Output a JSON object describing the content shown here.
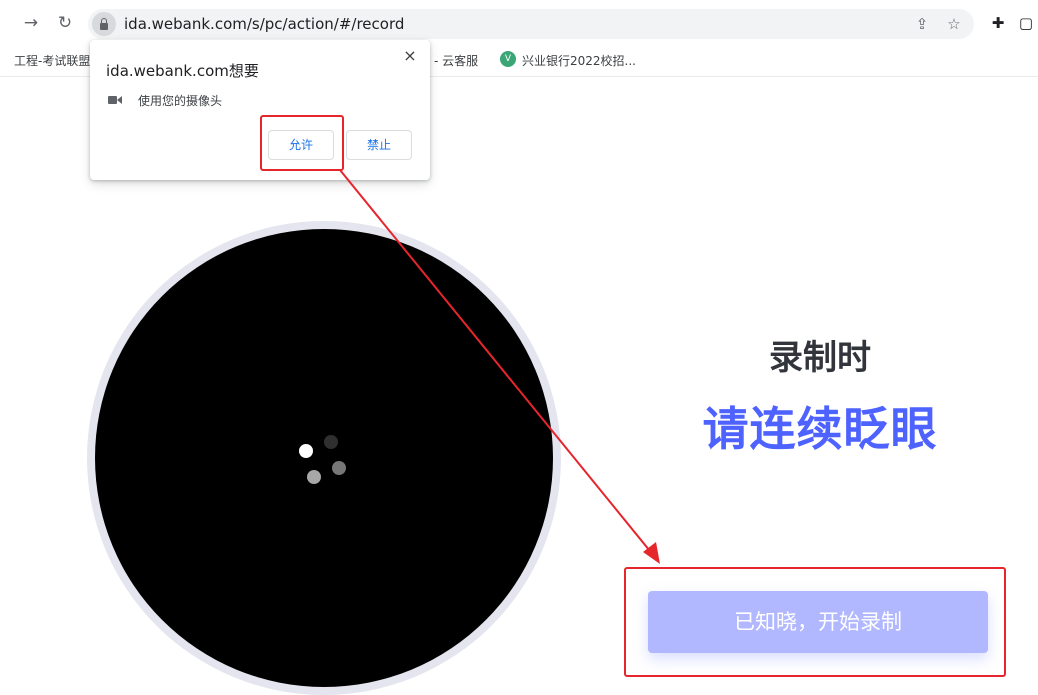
{
  "browser": {
    "url": "ida.webank.com/s/pc/action/#/record",
    "icons": [
      "forward-icon",
      "reload-icon",
      "lock-icon",
      "share-icon",
      "star-icon",
      "extensions-icon",
      "side-panel-icon"
    ]
  },
  "bookmarks": {
    "items": [
      {
        "label": "工程-考试联盟"
      },
      {
        "label": "- 云客服"
      },
      {
        "label": "兴业银行2022校招..."
      }
    ]
  },
  "permission_popup": {
    "title": "ida.webank.com想要",
    "permission": "使用您的摄像头",
    "allow_label": "允许",
    "block_label": "禁止",
    "close_label": "×"
  },
  "page": {
    "subtitle": "录制时",
    "instruction": "请连续眨眼",
    "start_button": "已知晓，开始录制"
  },
  "colors": {
    "accent": "#4e62ff",
    "button": "#b2b8ff",
    "annotation": "#e5262c",
    "link_blue": "#1a73e8"
  }
}
